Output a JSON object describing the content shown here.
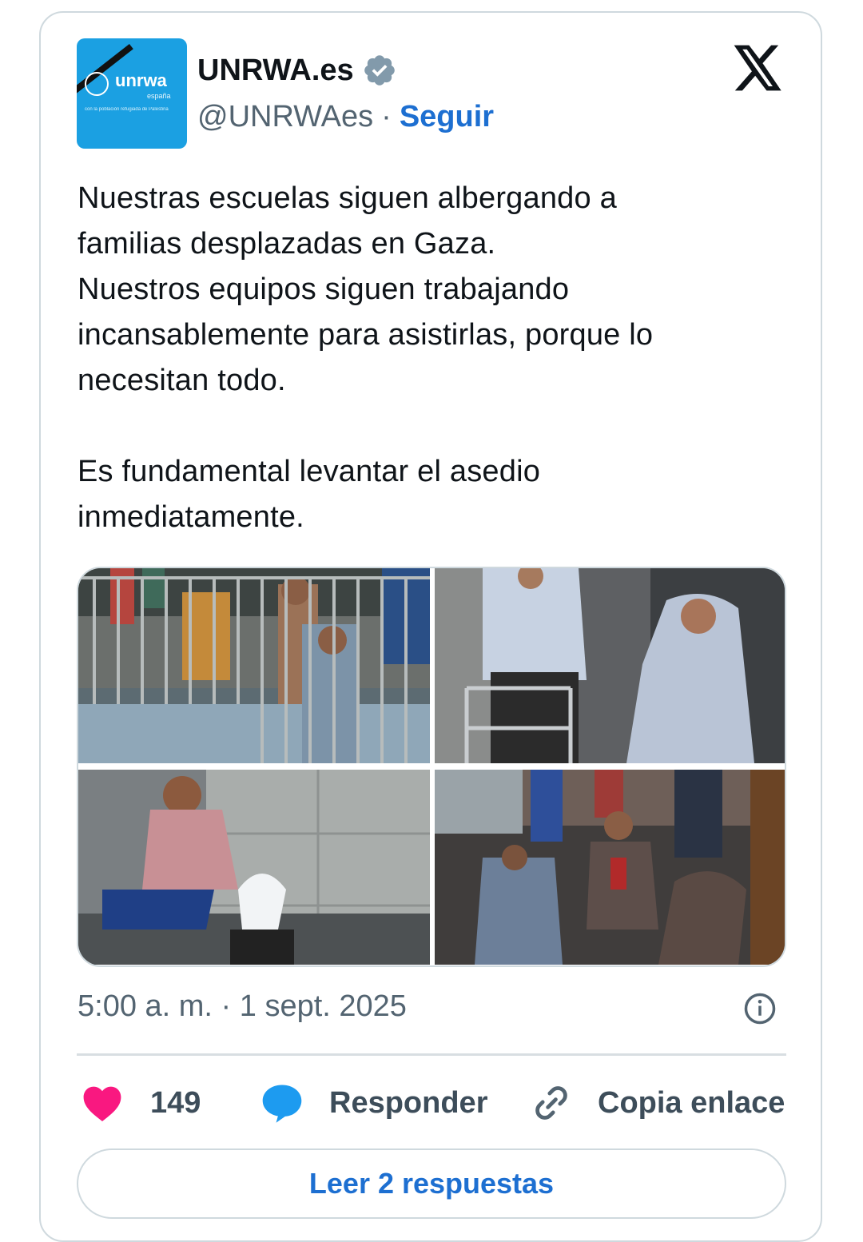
{
  "tweet": {
    "account": {
      "name": "UNRWA.es",
      "handle": "@UNRWAes",
      "separator": "·",
      "follow_label": "Seguir",
      "verified": true,
      "avatar_logo_text": "unrwa",
      "avatar_sub_text": "españa",
      "avatar_tagline": "con la población refugiada de Palestina"
    },
    "platform_icon": "x-logo-icon",
    "text": "Nuestras escuelas siguen albergando a\nfamilias desplazadas en Gaza.\nNuestros equipos siguen trabajando\nincansablemente para asistirlas, porque lo\nnecesitan todo.\n\nEs fundamental levantar el asedio\ninmediatamente.",
    "media": [
      {
        "kind": "photo",
        "subject": "children-behind-railing"
      },
      {
        "kind": "photo",
        "subject": "elderly-women-with-walker"
      },
      {
        "kind": "photo",
        "subject": "girl-washing-cloth"
      },
      {
        "kind": "photo",
        "subject": "families-in-shelter"
      }
    ],
    "timestamp": "5:00 a. m. · 1 sept. 2025",
    "actions": {
      "like_count": "149",
      "reply_label": "Responder",
      "copy_label": "Copia enlace"
    },
    "read_replies_label": "Leer 2 respuestas"
  },
  "colors": {
    "link_blue": "#1d6fd1",
    "like_pink": "#f91880",
    "reply_blue": "#1d9bf0",
    "avatar_blue": "#1ba0e2",
    "muted_text": "#536471"
  }
}
